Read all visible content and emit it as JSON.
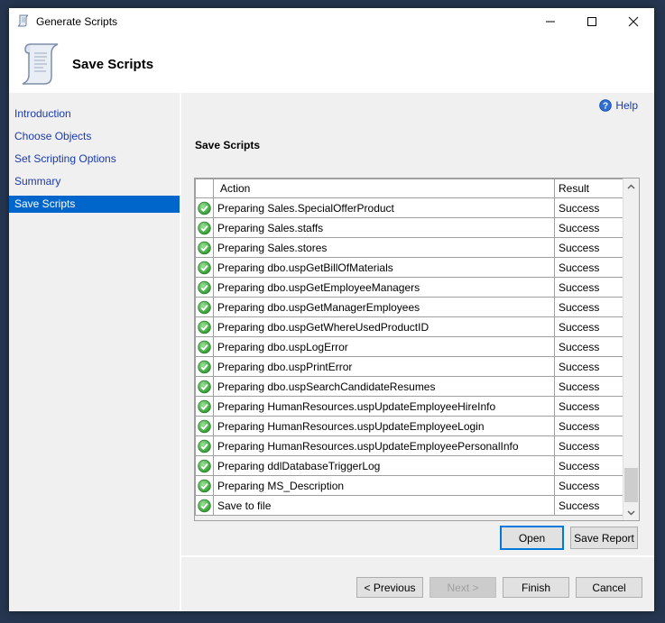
{
  "window": {
    "title": "Generate Scripts",
    "controls": {
      "minimize": "minimize",
      "maximize": "maximize",
      "close": "close"
    }
  },
  "header": {
    "title": "Save Scripts",
    "icon": "script-scroll-icon"
  },
  "sidebar": {
    "items": [
      {
        "label": "Introduction",
        "active": false
      },
      {
        "label": "Choose Objects",
        "active": false
      },
      {
        "label": "Set Scripting Options",
        "active": false
      },
      {
        "label": "Summary",
        "active": false
      },
      {
        "label": "Save Scripts",
        "active": true
      }
    ]
  },
  "main": {
    "help_label": "Help",
    "section_title": "Save Scripts",
    "grid": {
      "columns": [
        "",
        "Action",
        "Result"
      ],
      "rows": [
        {
          "status": "success-icon",
          "action": "Preparing Sales.SpecialOfferProduct",
          "result": "Success"
        },
        {
          "status": "success-icon",
          "action": "Preparing Sales.staffs",
          "result": "Success"
        },
        {
          "status": "success-icon",
          "action": "Preparing Sales.stores",
          "result": "Success"
        },
        {
          "status": "success-icon",
          "action": "Preparing dbo.uspGetBillOfMaterials",
          "result": "Success"
        },
        {
          "status": "success-icon",
          "action": "Preparing dbo.uspGetEmployeeManagers",
          "result": "Success"
        },
        {
          "status": "success-icon",
          "action": "Preparing dbo.uspGetManagerEmployees",
          "result": "Success"
        },
        {
          "status": "success-icon",
          "action": "Preparing dbo.uspGetWhereUsedProductID",
          "result": "Success"
        },
        {
          "status": "success-icon",
          "action": "Preparing dbo.uspLogError",
          "result": "Success"
        },
        {
          "status": "success-icon",
          "action": "Preparing dbo.uspPrintError",
          "result": "Success"
        },
        {
          "status": "success-icon",
          "action": "Preparing dbo.uspSearchCandidateResumes",
          "result": "Success"
        },
        {
          "status": "success-icon",
          "action": "Preparing HumanResources.uspUpdateEmployeeHireInfo",
          "result": "Success"
        },
        {
          "status": "success-icon",
          "action": "Preparing HumanResources.uspUpdateEmployeeLogin",
          "result": "Success"
        },
        {
          "status": "success-icon",
          "action": "Preparing HumanResources.uspUpdateEmployeePersonalInfo",
          "result": "Success"
        },
        {
          "status": "success-icon",
          "action": "Preparing ddlDatabaseTriggerLog",
          "result": "Success"
        },
        {
          "status": "success-icon",
          "action": "Preparing MS_Description",
          "result": "Success"
        },
        {
          "status": "success-icon",
          "action": "Save to file",
          "result": "Success"
        }
      ],
      "scroll_position": "bottom"
    },
    "open_label": "Open",
    "save_report_label": "Save Report"
  },
  "footer": {
    "previous_label": "< Previous",
    "next_label": "Next >",
    "finish_label": "Finish",
    "cancel_label": "Cancel"
  },
  "colors": {
    "accent": "#0066cc",
    "link": "#1a3aad",
    "success": "#3aa63a",
    "desktop": "#263650"
  }
}
